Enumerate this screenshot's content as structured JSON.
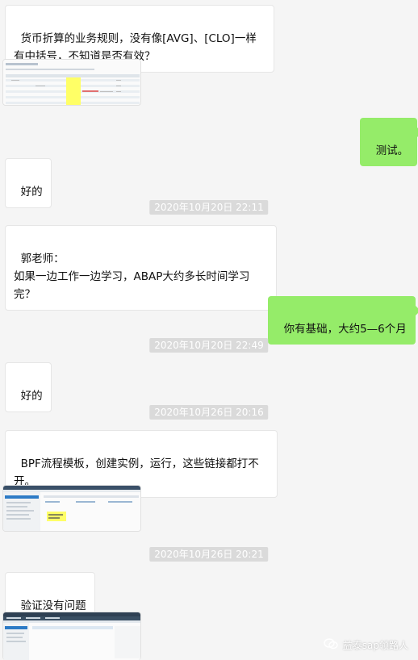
{
  "messages": {
    "m1": "货币折算的业务规则，没有像[AVG]、[CLO]一样有中括号，不知道是否有效？",
    "m2_out": "测试。",
    "m3": "好的",
    "ts1": "2020年10月20日  22:11",
    "m4": "郭老师：\n如果一边工作一边学习，ABAP大约多长时间学习完？",
    "m5_out": "你有基础，大约5—6个月",
    "ts2": "2020年10月20日  22:49",
    "m6": "好的",
    "ts3": "2020年10月26日  20:16",
    "m7": "BPF流程模板，创建实例，运行，这些链接都打不开。",
    "ts4": "2020年10月26日  20:21",
    "m8": "验证没有问题"
  },
  "watermark": {
    "text": "益泰sap领路人",
    "icon": "wechat-official-account-icon"
  },
  "colors": {
    "background": "#f5f5f5",
    "incoming_bubble": "#ffffff",
    "outgoing_bubble": "#95ec69",
    "timestamp_bg": "#dadada",
    "highlight": "#ffff66"
  }
}
